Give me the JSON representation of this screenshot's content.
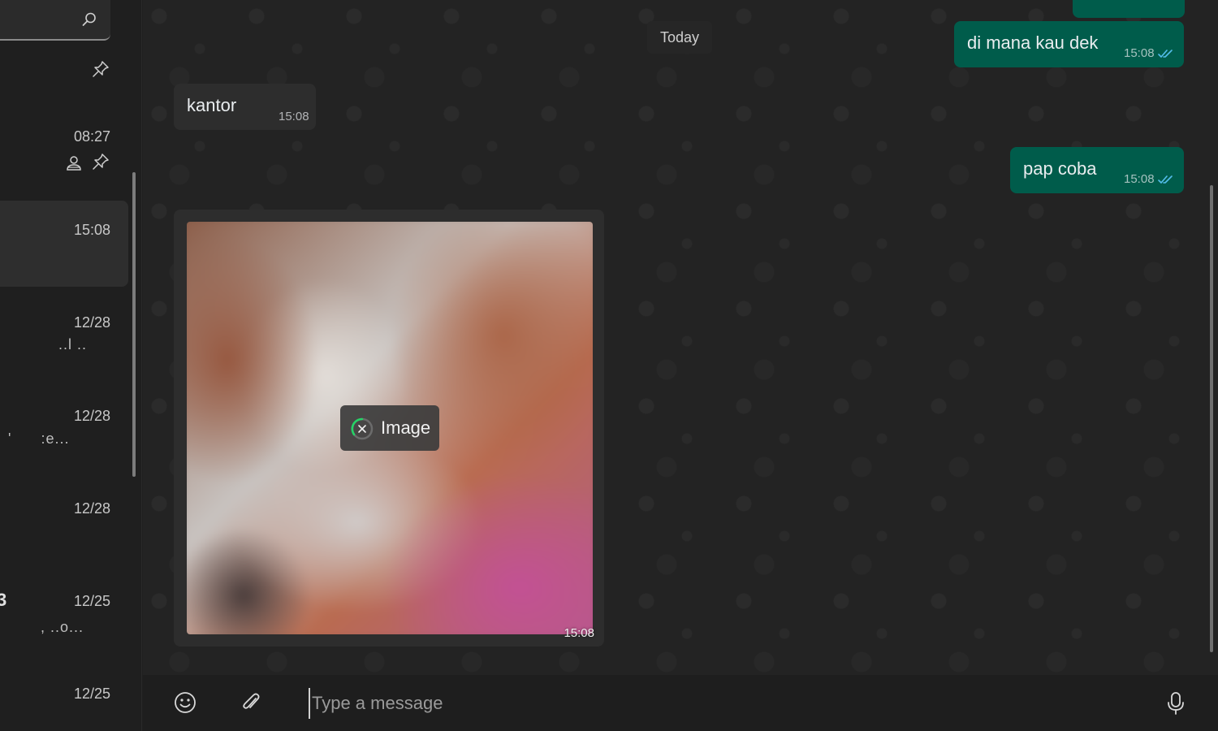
{
  "sidebar": {
    "search": {
      "icon": "search-icon"
    },
    "pinned_icon": "pin-icon",
    "chats": [
      {
        "time": "08:27",
        "snippet": "",
        "icons": [
          "community-icon",
          "pin-icon"
        ]
      },
      {
        "time": "15:08",
        "snippet": "",
        "active": true
      },
      {
        "time": "12/28",
        "snippet": "..l .."
      },
      {
        "time": "12/28",
        "snippet": "'      :e..."
      },
      {
        "time": "12/28",
        "snippet": ""
      },
      {
        "time": "12/25",
        "snippet": ", ..o...",
        "edge": "3"
      },
      {
        "time": "12/25",
        "snippet": ""
      }
    ]
  },
  "chat": {
    "date_divider": "Today",
    "messages": [
      {
        "id": "m1",
        "direction": "out",
        "text": "di mana kau dek",
        "time": "15:08",
        "status": "read"
      },
      {
        "id": "m2",
        "direction": "in",
        "text": "kantor",
        "time": "15:08"
      },
      {
        "id": "m3",
        "direction": "out",
        "text": "pap coba",
        "time": "15:08",
        "status": "read"
      },
      {
        "id": "m4",
        "direction": "in",
        "type": "image",
        "badge_label": "Image",
        "time": "15:08"
      }
    ]
  },
  "composer": {
    "placeholder": "Type a message",
    "value": ""
  },
  "colors": {
    "outgoing_bubble": "#005c4b",
    "incoming_bubble": "#2d2d2d",
    "read_ticks": "#53bdeb",
    "background": "#232323"
  }
}
